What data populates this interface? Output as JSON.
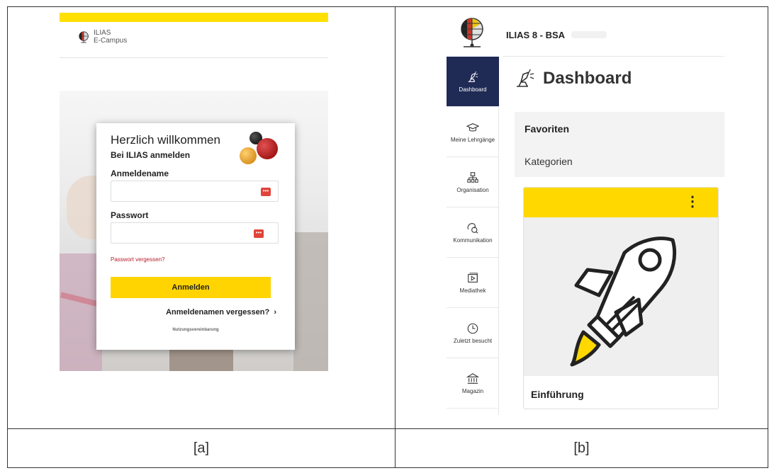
{
  "captions": {
    "a": "[a]",
    "b": "[b]"
  },
  "panel_a": {
    "logo_line1": "ILIAS",
    "logo_line2": "E-Campus",
    "welcome": "Herzlich willkommen",
    "subtitle": "Bei ILIAS anmelden",
    "username_label": "Anmeldename",
    "username_value": "",
    "password_label": "Passwort",
    "password_value": "",
    "forgot_password": "Passwort vergessen?",
    "login_button": "Anmelden",
    "forgot_username": "Anmeldenamen vergessen?",
    "terms": "Nutzungsvereinbarung",
    "colors": {
      "accent": "#ffd400",
      "link": "#b51c2c"
    }
  },
  "panel_b": {
    "app_title": "ILIAS 8 - BSA",
    "nav": [
      {
        "label": "Dashboard",
        "icon": "dashboard-icon",
        "active": true
      },
      {
        "label": "Meine Lehrgänge",
        "icon": "graduation-cap-icon",
        "active": false
      },
      {
        "label": "Organisation",
        "icon": "org-chart-icon",
        "active": false
      },
      {
        "label": "Kommunikation",
        "icon": "chat-bubble-icon",
        "active": false
      },
      {
        "label": "Mediathek",
        "icon": "media-icon",
        "active": false
      },
      {
        "label": "Zuletzt besucht",
        "icon": "clock-icon",
        "active": false
      },
      {
        "label": "Magazin",
        "icon": "bank-icon",
        "active": false
      }
    ],
    "page_title": "Dashboard",
    "favorites_title": "Favoriten",
    "favorites_sub": "Kategorien",
    "tile_name": "Einführung",
    "tile_menu": "⋮",
    "colors": {
      "nav_active": "#1f2a55",
      "tile_bar": "#ffd800"
    }
  }
}
